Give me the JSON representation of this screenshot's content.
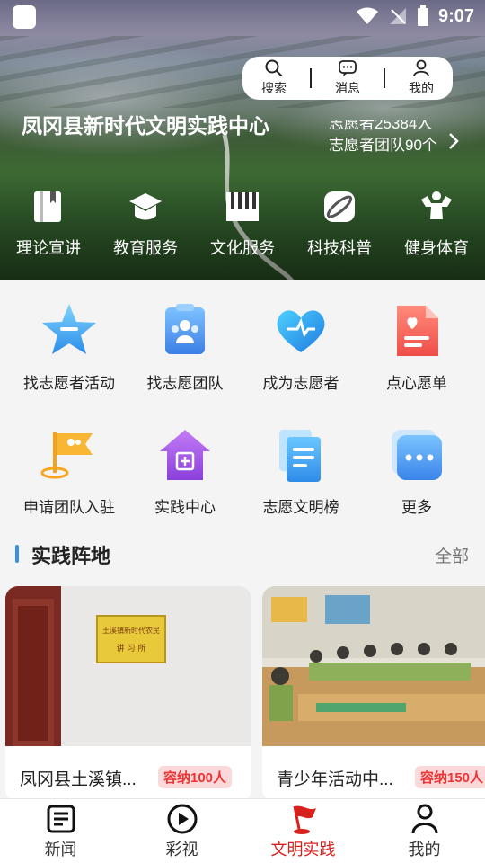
{
  "status_bar": {
    "time": "9:07"
  },
  "top_actions": [
    {
      "label": "搜索",
      "icon": "search-icon"
    },
    {
      "label": "消息",
      "icon": "message-icon"
    },
    {
      "label": "我的",
      "icon": "user-icon"
    }
  ],
  "hero": {
    "title": "凤冈县新时代文明实践中心",
    "stats": [
      "志愿者25384人",
      "志愿者团队90个"
    ],
    "categories": [
      {
        "label": "理论宣讲",
        "icon": "book-icon"
      },
      {
        "label": "教育服务",
        "icon": "graduation-cap-icon"
      },
      {
        "label": "文化服务",
        "icon": "piano-icon"
      },
      {
        "label": "科技科普",
        "icon": "planet-icon"
      },
      {
        "label": "健身体育",
        "icon": "bodybuilder-icon"
      }
    ]
  },
  "services": [
    {
      "label": "找志愿者活动",
      "icon": "star-chat-icon"
    },
    {
      "label": "找志愿团队",
      "icon": "team-icon"
    },
    {
      "label": "成为志愿者",
      "icon": "heart-icon"
    },
    {
      "label": "点心愿单",
      "icon": "wish-list-icon"
    },
    {
      "label": "申请团队入驻",
      "icon": "flag-icon"
    },
    {
      "label": "实践中心",
      "icon": "house-icon"
    },
    {
      "label": "志愿文明榜",
      "icon": "document-icon"
    },
    {
      "label": "更多",
      "icon": "more-icon"
    }
  ],
  "section": {
    "title": "实践阵地",
    "more_label": "全部"
  },
  "cards": [
    {
      "name": "凤冈县土溪镇...",
      "capacity": "容纳100人",
      "sign_line1": "土溪镇新时代农民",
      "sign_line2": "讲 习 所"
    },
    {
      "name": "青少年活动中...",
      "capacity": "容纳150人"
    }
  ],
  "tabs": [
    {
      "label": "新闻",
      "icon": "news-icon",
      "active": false
    },
    {
      "label": "彩视",
      "icon": "play-icon",
      "active": false
    },
    {
      "label": "文明实践",
      "icon": "flag-icon",
      "active": true
    },
    {
      "label": "我的",
      "icon": "profile-icon",
      "active": false
    }
  ],
  "colors": {
    "accent": "#d8211c",
    "section_bar": "#3b8ee6",
    "capacity_text": "#ee3333",
    "capacity_bg": "#fbd9da"
  }
}
